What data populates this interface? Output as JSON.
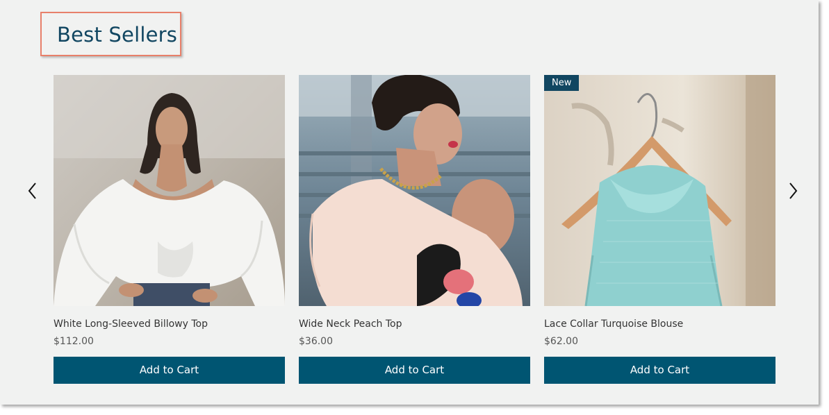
{
  "section": {
    "title": "Best Sellers"
  },
  "colors": {
    "accent": "#005572",
    "title": "#114661",
    "highlight_border": "#e8806a",
    "background": "#f1f2f1"
  },
  "navigation": {
    "prev_icon": "chevron-left-icon",
    "next_icon": "chevron-right-icon"
  },
  "products": [
    {
      "name": "White Long-Sleeved Billowy Top",
      "price": "$112.00",
      "button": "Add to Cart",
      "ribbon": ""
    },
    {
      "name": "Wide Neck Peach Top",
      "price": "$36.00",
      "button": "Add to Cart",
      "ribbon": ""
    },
    {
      "name": "Lace Collar Turquoise Blouse",
      "price": "$62.00",
      "button": "Add to Cart",
      "ribbon": "New"
    }
  ]
}
